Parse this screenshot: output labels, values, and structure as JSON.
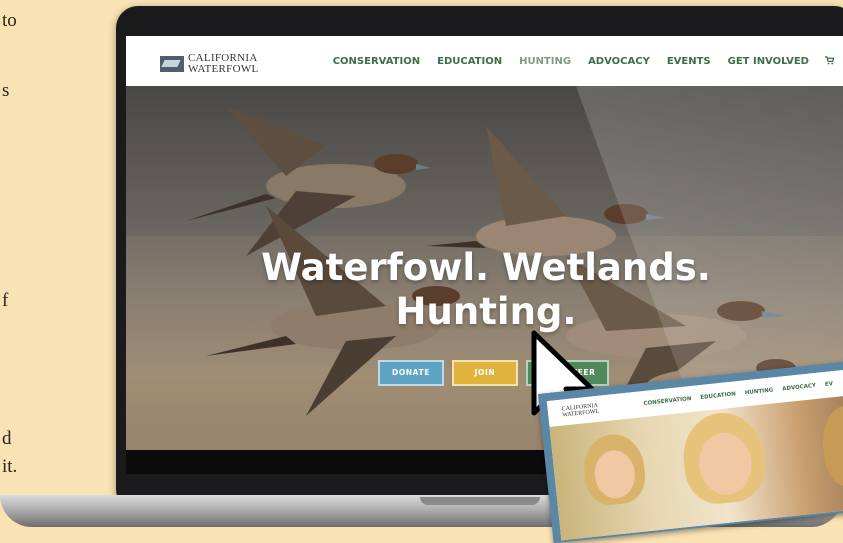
{
  "side_text": [
    "to",
    "s",
    "f",
    "d",
    "it."
  ],
  "site": {
    "logo_line1": "CALIFORNIA",
    "logo_line2": "WATERFOWL",
    "nav": [
      "CONSERVATION",
      "EDUCATION",
      "HUNTING",
      "ADVOCACY",
      "EVENTS",
      "GET INVOLVED"
    ],
    "active_nav": "HUNTING",
    "cart_icon": "cart-icon",
    "hero_title_line1": "Waterfowl. Wetlands.",
    "hero_title_line2": "Hunting.",
    "buttons": {
      "donate": "DONATE",
      "join": "JOIN",
      "volunteer": "VOLUNTEER"
    }
  },
  "tablet": {
    "logo_line1": "CALIFORNIA",
    "logo_line2": "WATERFOWL",
    "nav": [
      "CONSERVATION",
      "EDUCATION",
      "HUNTING",
      "ADVOCACY",
      "EV"
    ]
  },
  "colors": {
    "background": "#f9e2b4",
    "nav_green": "#3c6e47",
    "donate_blue": "#5ea3c4",
    "join_yellow": "#e0b43c",
    "volunteer_green": "#4f8a5b"
  }
}
